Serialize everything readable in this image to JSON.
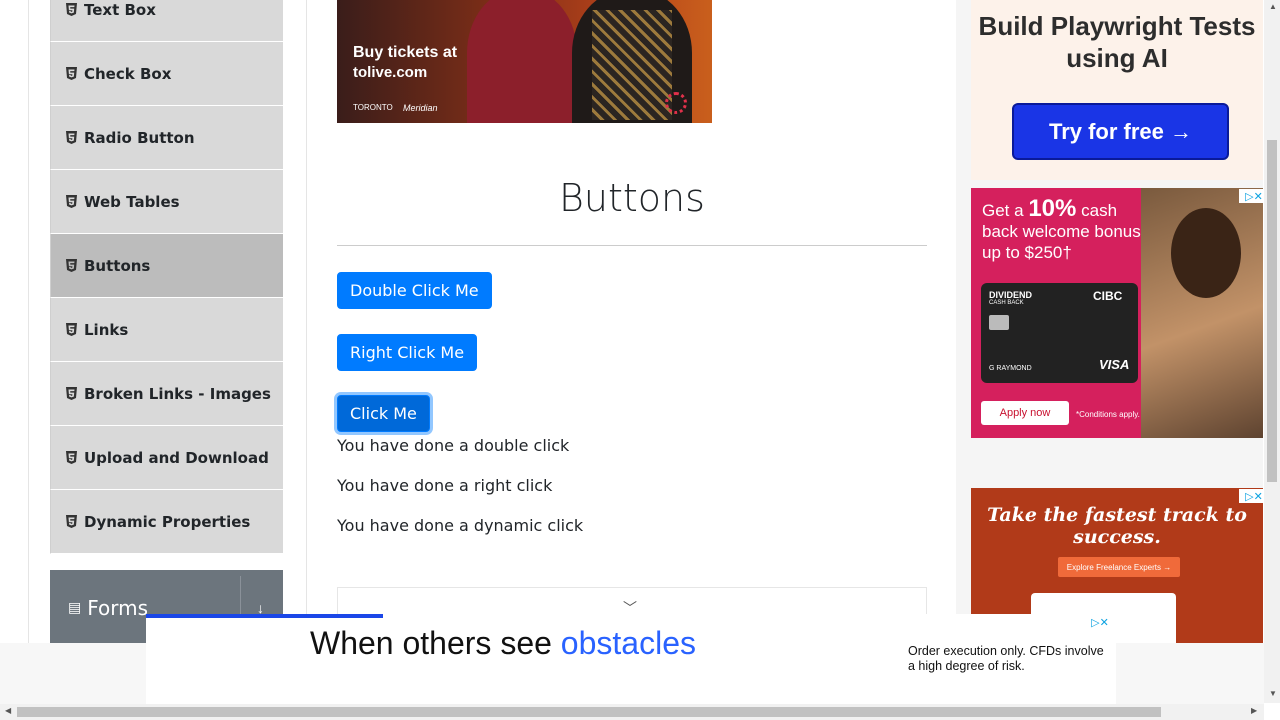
{
  "sidebar": {
    "items": [
      {
        "label": "Text Box",
        "active": false
      },
      {
        "label": "Check Box",
        "active": false
      },
      {
        "label": "Radio Button",
        "active": false
      },
      {
        "label": "Web Tables",
        "active": false
      },
      {
        "label": "Buttons",
        "active": true
      },
      {
        "label": "Links",
        "active": false
      },
      {
        "label": "Broken Links - Images",
        "active": false
      },
      {
        "label": "Upload and Download",
        "active": false
      },
      {
        "label": "Dynamic Properties",
        "active": false
      }
    ],
    "forms_label": "Forms"
  },
  "banner": {
    "line1": "Buy tickets at",
    "line2": "tolive.com",
    "partner1": "TORONTO",
    "partner2": "Meridian"
  },
  "main": {
    "title": "Buttons",
    "double_click_label": "Double Click Me",
    "right_click_label": "Right Click Me",
    "click_label": "Click Me",
    "messages": [
      "You have done a double click",
      "You have done a right click",
      "You have done a dynamic click"
    ]
  },
  "ads": {
    "ad1_title": "Build Playwright Tests using AI",
    "ad1_cta": "Try for free →",
    "ad2_line1": "Get a",
    "ad2_pct": "10%",
    "ad2_line2": "cash back welcome bonus up to $250†",
    "ad2_card_name": "DIVIDEND",
    "ad2_card_sub": "CASH BACK",
    "ad2_card_bank": "CIBC",
    "ad2_card_holder": "G RAYMOND",
    "ad2_card_brand": "VISA",
    "ad2_apply": "Apply now",
    "ad2_cond": "*Conditions apply.",
    "ad3_title": "Take the fastest track to success.",
    "ad3_button": "Explore Freelance Experts →",
    "bottom_text_a": "When others see ",
    "bottom_text_b": "obstacles",
    "bottom_disclaimer": "Order execution only. CFDs involve a high degree of risk."
  },
  "colors": {
    "primary": "#007bff",
    "sidebar_bg": "#d9d9d9",
    "sidebar_active": "#bcbcbc",
    "forms_bg": "#6c757d"
  }
}
